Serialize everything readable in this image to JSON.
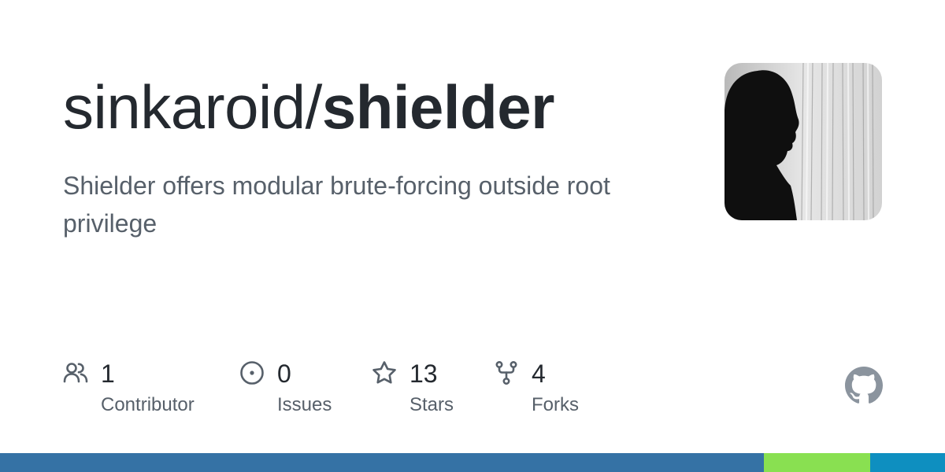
{
  "repo": {
    "owner": "sinkaroid/",
    "name": "shielder",
    "description": "Shielder offers modular brute-forcing outside root privilege"
  },
  "avatar": {
    "icon": "owner-avatar"
  },
  "stats": [
    {
      "icon": "people-icon",
      "value": "1",
      "label": "Contributor"
    },
    {
      "icon": "issue-opened-icon",
      "value": "0",
      "label": "Issues"
    },
    {
      "icon": "star-icon",
      "value": "13",
      "label": "Stars"
    },
    {
      "icon": "repo-forked-icon",
      "value": "4",
      "label": "Forks"
    }
  ],
  "brand": {
    "icon": "github-mark-icon",
    "color": "#8b949e"
  },
  "colors": {
    "text": "#24292f",
    "muted": "#57606a",
    "icon": "#57606a"
  },
  "language_bar": [
    {
      "color": "#3572A5",
      "share": 0.808
    },
    {
      "color": "#89e051",
      "share": 0.113
    },
    {
      "color": "#0e8fc0",
      "share": 0.079
    }
  ]
}
